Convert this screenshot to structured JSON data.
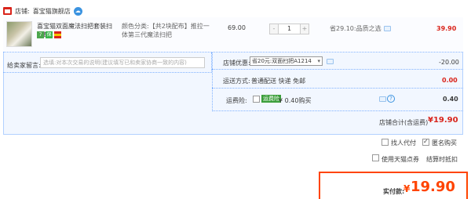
{
  "store": {
    "label": "店铺:",
    "name": "喜宝猫旗舰店",
    "wangwang_icon": "chat-bubble-icon"
  },
  "item": {
    "thumbnail_icon": "mop-product-image",
    "title": "喜宝猫双面魔法扫把套装扫帚簸...",
    "badges": [
      "7",
      "保",
      "flag"
    ],
    "sku": "颜色分类:【共2块配布】推拉一体第三代魔法扫把",
    "unit_price": "69.00",
    "quantity": "1",
    "qty_minus": "-",
    "qty_plus": "+",
    "promo": "省29.10:品质之选",
    "total": "39.90"
  },
  "message": {
    "label": "给卖家留言:",
    "placeholder": "选填:对本次交易的说明(建议填写已和卖家协商一致的内容)"
  },
  "shop_discount": {
    "label": "店铺优惠:",
    "selected": "省20元:双面扫把A1214",
    "amount": "-20.00"
  },
  "shipping": {
    "label": "运送方式:",
    "value": "普通配送 快递 免邮",
    "amount": "0.00"
  },
  "insurance": {
    "label": "运费险:",
    "tag": "运费险",
    "price": "¥ 0.40购买",
    "help": "?",
    "amount": "0.40"
  },
  "store_total": {
    "label": "店铺合计(含运费)",
    "value": "¥19.90"
  },
  "options": {
    "proxy_pay": "找人代付",
    "anonymous": "匿名购买",
    "tmall_points": "使用天猫点券",
    "installment": "结算时抵扣"
  },
  "pay": {
    "label": "实付款:",
    "currency": "¥",
    "value": "19.90"
  },
  "colors": {
    "accent": "#ff4400",
    "price_red": "#d9241b",
    "block_bg": "#f2f7ff",
    "border_blue": "#b2d1ff"
  }
}
